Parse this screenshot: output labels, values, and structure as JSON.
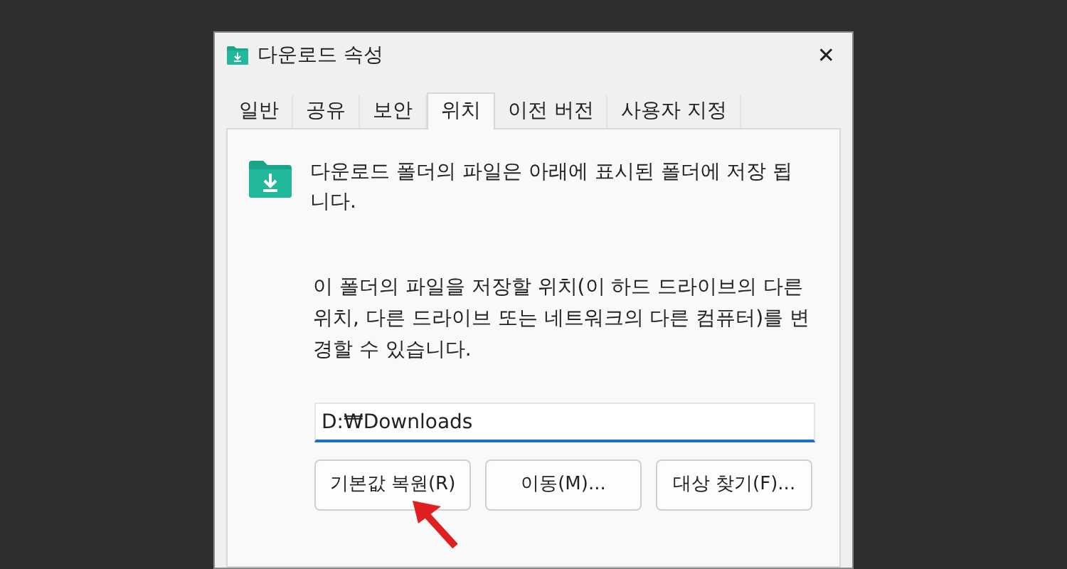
{
  "window": {
    "title": "다운로드 속성",
    "close": "✕"
  },
  "tabs": [
    {
      "label": "일반",
      "selected": false
    },
    {
      "label": "공유",
      "selected": false
    },
    {
      "label": "보안",
      "selected": false
    },
    {
      "label": "위치",
      "selected": true
    },
    {
      "label": "이전 버전",
      "selected": false
    },
    {
      "label": "사용자 지정",
      "selected": false
    }
  ],
  "intro": "다운로드 폴더의 파일은 아래에 표시된 폴더에 저장 됩니다.",
  "description": "이 폴더의 파일을 저장할 위치(이 하드 드라이브의 다른 위치, 다른 드라이브 또는 네트워크의 다른 컴퓨터)를 변경할 수 있습니다.",
  "path_field": {
    "value": "D:₩Downloads"
  },
  "buttons": [
    "기본값 복원(R)",
    "이동(M)...",
    "대상 찾기(F)..."
  ]
}
